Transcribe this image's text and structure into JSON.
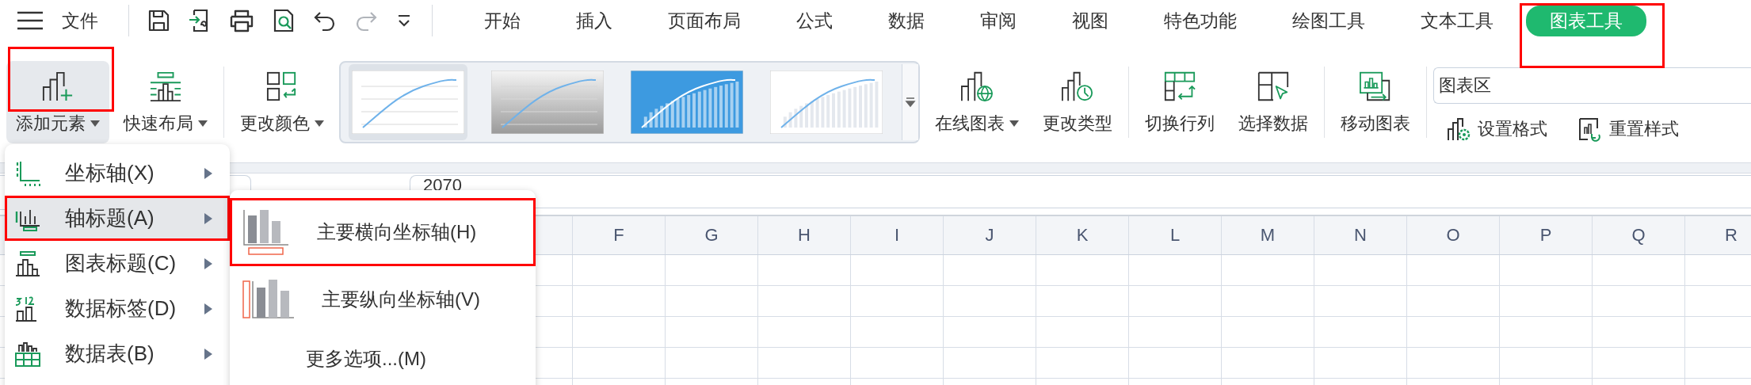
{
  "topbar": {
    "file_label": "文件",
    "quick_tools": [
      {
        "kind": "save",
        "disabled": false
      },
      {
        "kind": "export",
        "disabled": false
      },
      {
        "kind": "print",
        "disabled": false
      },
      {
        "kind": "preview",
        "disabled": false
      },
      {
        "kind": "undo",
        "disabled": false
      },
      {
        "kind": "redo",
        "disabled": true
      },
      {
        "kind": "more",
        "disabled": false
      }
    ],
    "tabs": [
      {
        "label": "开始",
        "selected": false,
        "annotated": false
      },
      {
        "label": "插入",
        "selected": false,
        "annotated": false
      },
      {
        "label": "页面布局",
        "selected": false,
        "annotated": false
      },
      {
        "label": "公式",
        "selected": false,
        "annotated": false
      },
      {
        "label": "数据",
        "selected": false,
        "annotated": false
      },
      {
        "label": "审阅",
        "selected": false,
        "annotated": false
      },
      {
        "label": "视图",
        "selected": false,
        "annotated": false
      },
      {
        "label": "特色功能",
        "selected": false,
        "annotated": false
      },
      {
        "label": "绘图工具",
        "selected": false,
        "annotated": false
      },
      {
        "label": "文本工具",
        "selected": false,
        "annotated": false
      },
      {
        "label": "图表工具",
        "selected": true,
        "annotated": true
      }
    ]
  },
  "ribbon": {
    "groups": [
      {
        "kind": "buttons",
        "buttons": [
          {
            "kind": "add-element",
            "label": "添加元素",
            "dropdown": true,
            "pressed": true,
            "annotated": true
          },
          {
            "kind": "quick-layout",
            "label": "快速布局",
            "dropdown": true,
            "pressed": false,
            "annotated": false
          }
        ]
      },
      {
        "kind": "buttons",
        "buttons": [
          {
            "kind": "change-color",
            "label": "更改颜色",
            "dropdown": true,
            "pressed": false,
            "annotated": false
          }
        ]
      },
      {
        "kind": "gallery",
        "styles": [
          {
            "kind": "plain",
            "selected": true
          },
          {
            "kind": "gray",
            "selected": false
          },
          {
            "kind": "blue",
            "selected": false
          },
          {
            "kind": "columns",
            "selected": false
          }
        ]
      },
      {
        "kind": "buttons",
        "buttons": [
          {
            "kind": "online-chart",
            "label": "在线图表",
            "dropdown": true,
            "pressed": false,
            "annotated": false
          },
          {
            "kind": "change-type",
            "label": "更改类型",
            "dropdown": false,
            "pressed": false,
            "annotated": false
          }
        ]
      },
      {
        "kind": "buttons",
        "buttons": [
          {
            "kind": "switch-row-col",
            "label": "切换行列",
            "dropdown": false,
            "pressed": false,
            "annotated": false
          },
          {
            "kind": "select-data",
            "label": "选择数据",
            "dropdown": false,
            "pressed": false,
            "annotated": false
          }
        ]
      },
      {
        "kind": "buttons",
        "buttons": [
          {
            "kind": "move-chart",
            "label": "移动图表",
            "dropdown": false,
            "pressed": false,
            "annotated": false
          }
        ]
      },
      {
        "kind": "format",
        "element_select": "图表区",
        "buttons": [
          {
            "kind": "set-format",
            "label": "设置格式"
          },
          {
            "kind": "reset-style",
            "label": "重置样式"
          }
        ]
      }
    ]
  },
  "formula_bar": {
    "value": "2070"
  },
  "sheet": {
    "columns": [
      "F",
      "G",
      "H",
      "I",
      "J",
      "K",
      "L",
      "M",
      "N",
      "O",
      "P",
      "Q",
      "R"
    ]
  },
  "element_menu": {
    "items": [
      {
        "kind": "axes",
        "label": "坐标轴(X)",
        "submenu": true,
        "selected": false,
        "annotated": false
      },
      {
        "kind": "axis-titles",
        "label": "轴标题(A)",
        "submenu": true,
        "selected": true,
        "annotated": true
      },
      {
        "kind": "chart-title",
        "label": "图表标题(C)",
        "submenu": true,
        "selected": false,
        "annotated": false
      },
      {
        "kind": "data-labels",
        "label": "数据标签(D)",
        "submenu": true,
        "selected": false,
        "annotated": false
      },
      {
        "kind": "data-table",
        "label": "数据表(B)",
        "submenu": true,
        "selected": false,
        "annotated": false
      }
    ]
  },
  "axis_title_menu": {
    "items": [
      {
        "kind": "horizontal",
        "label": "主要横向坐标轴(H)",
        "annotated": true
      },
      {
        "kind": "vertical",
        "label": "主要纵向坐标轴(V)",
        "annotated": false
      },
      {
        "kind": "none",
        "label": "更多选项...(M)",
        "annotated": false
      }
    ]
  }
}
